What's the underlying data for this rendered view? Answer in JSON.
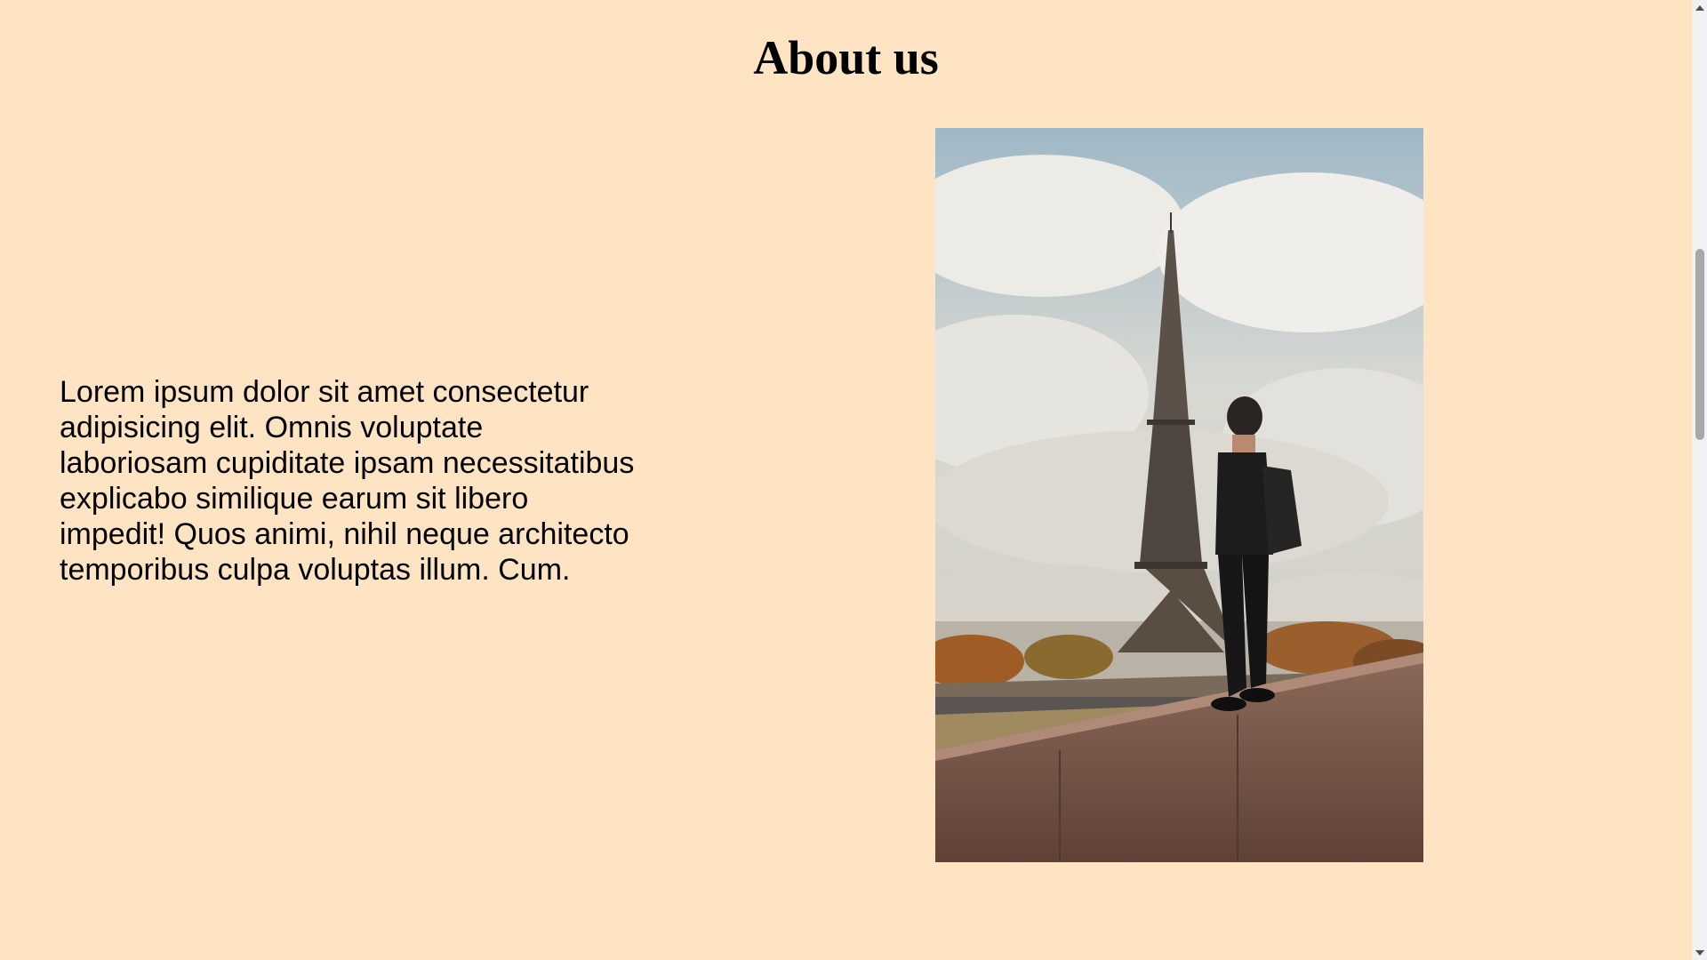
{
  "page": {
    "background": "#ffe4c4",
    "title": "About us",
    "paragraph": "Lorem ipsum dolor sit amet consectetur adipisicing elit. Omnis voluptate laboriosam cupiditate ipsam necessitatibus explicabo similique earum sit libero impedit! Quos animi, nihil neque architecto temporibus culpa voluptas illum. Cum."
  },
  "image": {
    "subject": "photo-eiffel-tower-traveler",
    "icon": "photo-icon"
  },
  "scrollbar": {
    "up_icon": "arrow-up-icon",
    "down_icon": "arrow-down-icon"
  }
}
